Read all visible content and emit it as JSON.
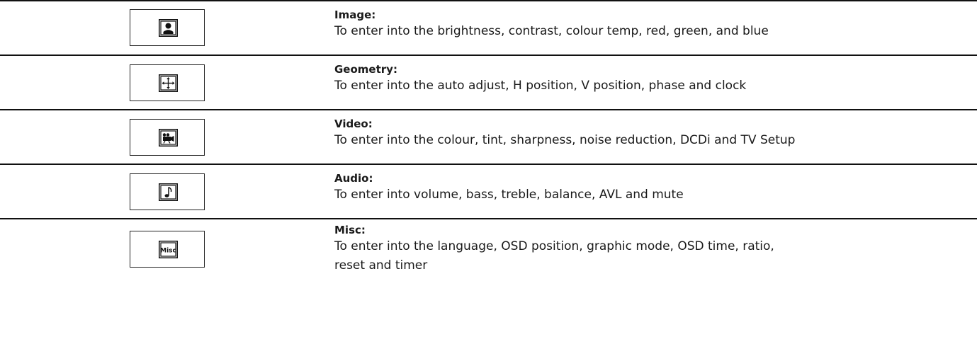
{
  "menu_items": [
    {
      "title": "Image:",
      "description": "To enter into the brightness, contrast, colour temp, red, green, and blue",
      "icon": "person-portrait-icon"
    },
    {
      "title": "Geometry:",
      "description": "To enter into the auto adjust, H position, V position, phase and clock",
      "icon": "four-way-arrows-icon"
    },
    {
      "title": "Video:",
      "description": "To enter into the colour, tint, sharpness, noise reduction, DCDi and TV Setup",
      "icon": "video-camera-icon"
    },
    {
      "title": "Audio:",
      "description": "To enter into volume, bass, treble, balance, AVL and mute",
      "icon": "music-note-icon"
    },
    {
      "title": "Misc:",
      "description": "To enter into the language, OSD position, graphic mode, OSD time, ratio, reset and timer",
      "icon": "misc-icon",
      "icon_text": "Misc"
    }
  ]
}
